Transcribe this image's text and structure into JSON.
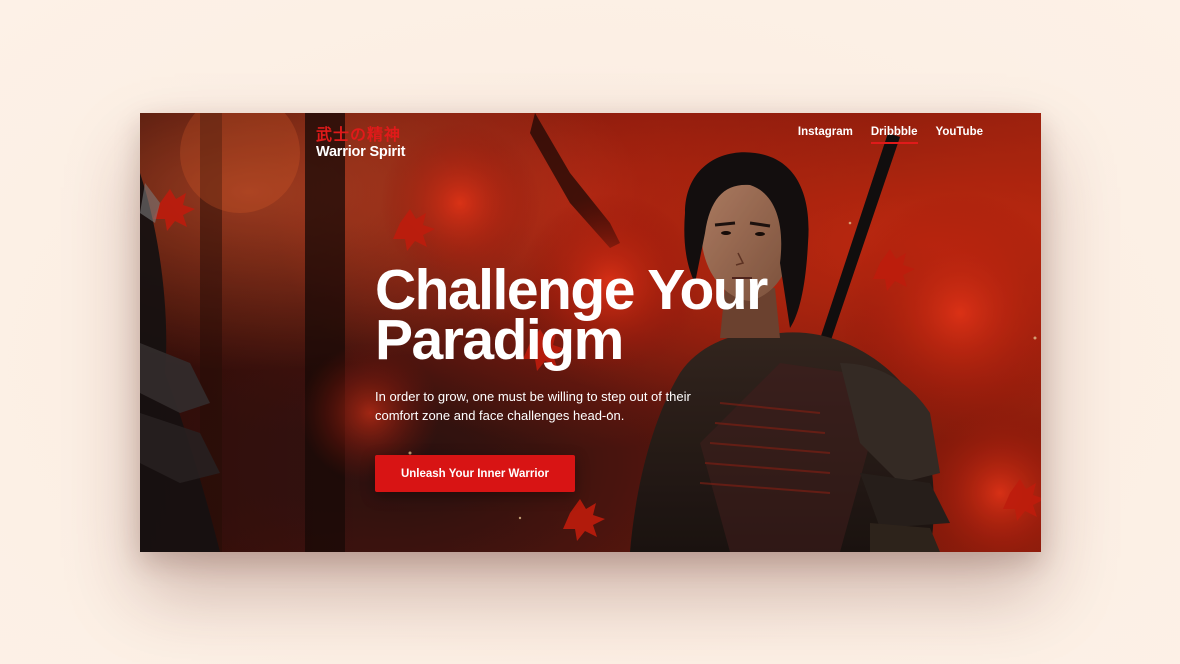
{
  "brand": {
    "kanji": "武士の精神",
    "name": "Warrior Spirit"
  },
  "nav": {
    "items": [
      {
        "label": "Instagram",
        "active": false
      },
      {
        "label": "Dribbble",
        "active": true
      },
      {
        "label": "YouTube",
        "active": false
      }
    ]
  },
  "hero": {
    "headline_line1": "Challenge Your",
    "headline_line2": "Paradigm",
    "subtitle": "In order to grow, one must be willing to step out of their comfort zone and face challenges head-on.",
    "cta_label": "Unleash Your Inner Warrior"
  },
  "colors": {
    "accent": "#d81414",
    "page_background": "#fcefe4",
    "text": "#ffffff"
  }
}
